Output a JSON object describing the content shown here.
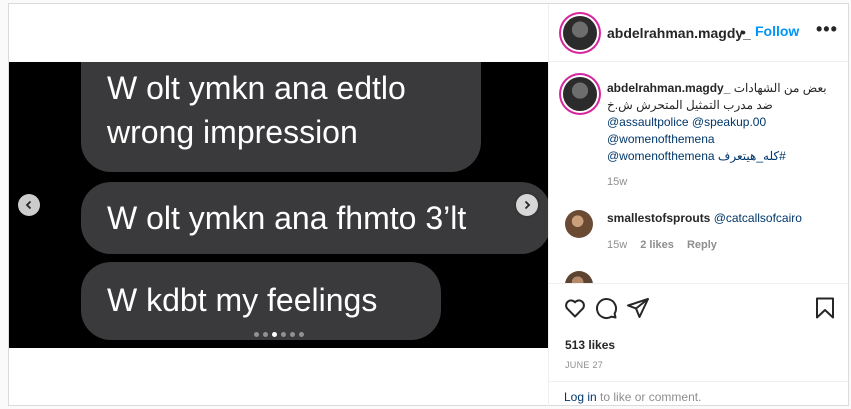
{
  "post": {
    "username": "abdelrahman.magdy_",
    "follow_label": "Follow",
    "separator": "•",
    "more_label": "•••"
  },
  "media": {
    "bubbles": [
      {
        "line1": "W olt ymkn ana edtlo",
        "line2": "wrong impression"
      },
      {
        "line1": "W olt ymkn ana fhmto 3’lt"
      },
      {
        "line1": "W kdbt my feelings"
      }
    ],
    "dot_count": 6,
    "active_dot": 2
  },
  "caption": {
    "username": "abdelrahman.magdy_",
    "text_line1": "بعض من الشهادات",
    "text_line2": "ضد مدرب التمثيل المتحرش ش.خ",
    "tag1": "@assaultpolice",
    "tag2": "@speakup.00",
    "tag3": "@womenofthemena",
    "tag4": "@womenofthemena",
    "hashtag": "#كله_هيتعرف",
    "time": "15w"
  },
  "comment": {
    "username": "smallestofsprouts",
    "mention": "@catcallsofcairo",
    "time": "15w",
    "likes": "2 likes",
    "reply": "Reply"
  },
  "engagement": {
    "likes": "513 likes",
    "date": "JUNE 27"
  },
  "login": {
    "link": "Log in",
    "text": " to like or comment."
  },
  "icons": [
    "heart-icon",
    "comment-icon",
    "share-icon",
    "bookmark-icon",
    "chevron-left-icon",
    "chevron-right-icon"
  ]
}
